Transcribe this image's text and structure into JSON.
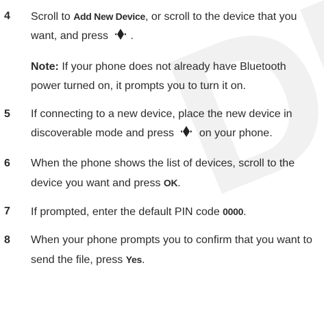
{
  "watermark": "DRAFT",
  "steps": [
    {
      "number": "4",
      "text_before": "Scroll to ",
      "keyword": "Add New Device",
      "text_after": ", or scroll to the device that you want, and press ",
      "icon": "nav-key-select-icon",
      "text_end": ".",
      "note_label": "Note:",
      "note_text": " If your phone does not already have Bluetooth power turned on, it prompts you to turn it on."
    },
    {
      "number": "5",
      "text_before": "If connecting to a new device, place the new device in discoverable mode and press ",
      "icon": "nav-key-select-icon",
      "text_after": " on your phone."
    },
    {
      "number": "6",
      "text_before": "When the phone shows the list of devices, scroll to the device you want and press ",
      "keyword": "OK",
      "text_after": "."
    },
    {
      "number": "7",
      "text_before": "If prompted, enter the default PIN code ",
      "keyword": "0000",
      "text_after": "."
    },
    {
      "number": "8",
      "text_before": "When your phone prompts you to confirm that you want to send the file, press ",
      "keyword": "Yes",
      "text_after": "."
    }
  ]
}
